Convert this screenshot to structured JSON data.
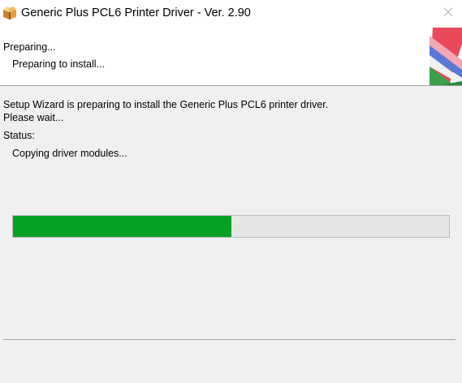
{
  "window": {
    "title": "Generic Plus PCL6 Printer Driver - Ver. 2.90",
    "icon": "package-box-icon",
    "close_icon": "close-icon"
  },
  "header": {
    "title": "Preparing...",
    "subtitle": "Preparing to install...",
    "graphic": "wizard-banner-graphic"
  },
  "body": {
    "message_line1": "Setup Wizard is preparing to install the Generic Plus PCL6 printer driver.",
    "message_line2": "Please wait...",
    "status_label": "Status:",
    "status_text": "Copying driver modules...",
    "progress": 0.5,
    "progress_color": "#06a025"
  }
}
